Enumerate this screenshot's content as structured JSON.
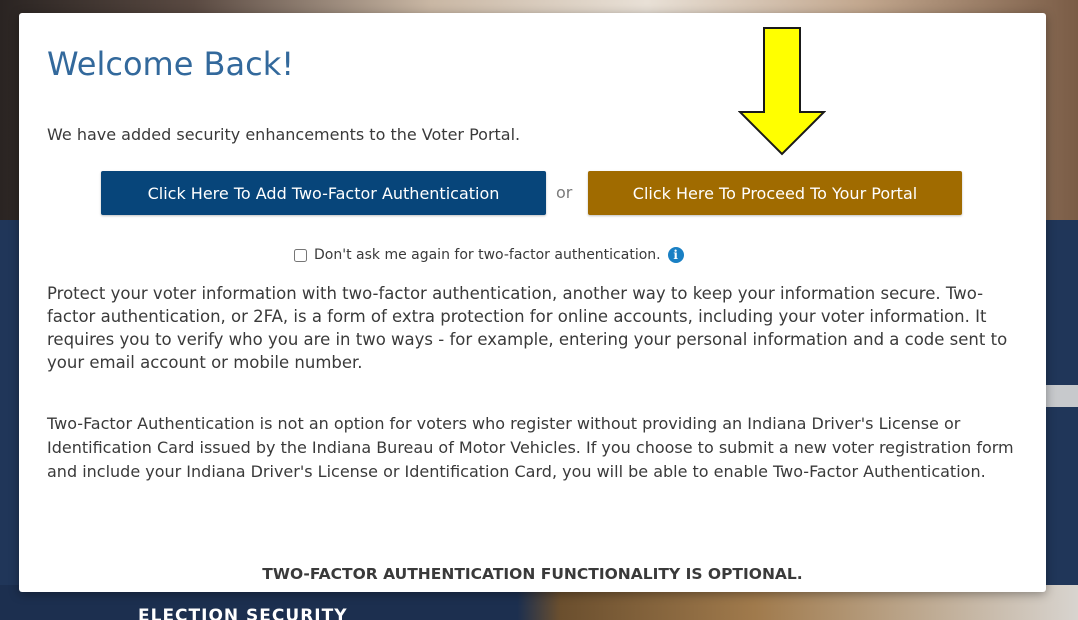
{
  "background": {
    "caption": "ELECTION SECURITY"
  },
  "modal": {
    "title": "Welcome Back!",
    "intro": "We have added security enhancements to the Voter Portal.",
    "add_2fa_button": "Click Here To Add Two-Factor Authentication",
    "or_text": "or",
    "proceed_button": "Click Here To Proceed To Your Portal",
    "dont_ask_label": "Don't ask me again for two-factor authentication.",
    "dont_ask_checked": false,
    "info_icon": "info-circle-icon",
    "paragraph_1": "Protect your voter information with two-factor authentication, another way to keep your information secure. Two-factor authentication, or 2FA, is a form of extra protection for online accounts, including your voter information. It requires you to verify who you are in two ways - for example, entering your personal information and a code sent to your email account or mobile number.",
    "paragraph_2": "Two-Factor Authentication is not an option for voters who register without providing an Indiana Driver's License or Identification Card issued by the Indiana Bureau of Motor Vehicles. If you choose to submit a new voter registration form and include your Indiana Driver's License or Identification Card, you will be able to enable Two-Factor Authentication.",
    "optional_notice": "TWO-FACTOR AUTHENTICATION FUNCTIONALITY IS OPTIONAL."
  },
  "annotation": {
    "arrow_icon": "down-arrow-icon",
    "arrow_color": "#ffff00"
  },
  "colors": {
    "title": "#33699c",
    "add_2fa_button": "#07457a",
    "proceed_button": "#a06b00",
    "info_icon": "#1a80c4"
  }
}
